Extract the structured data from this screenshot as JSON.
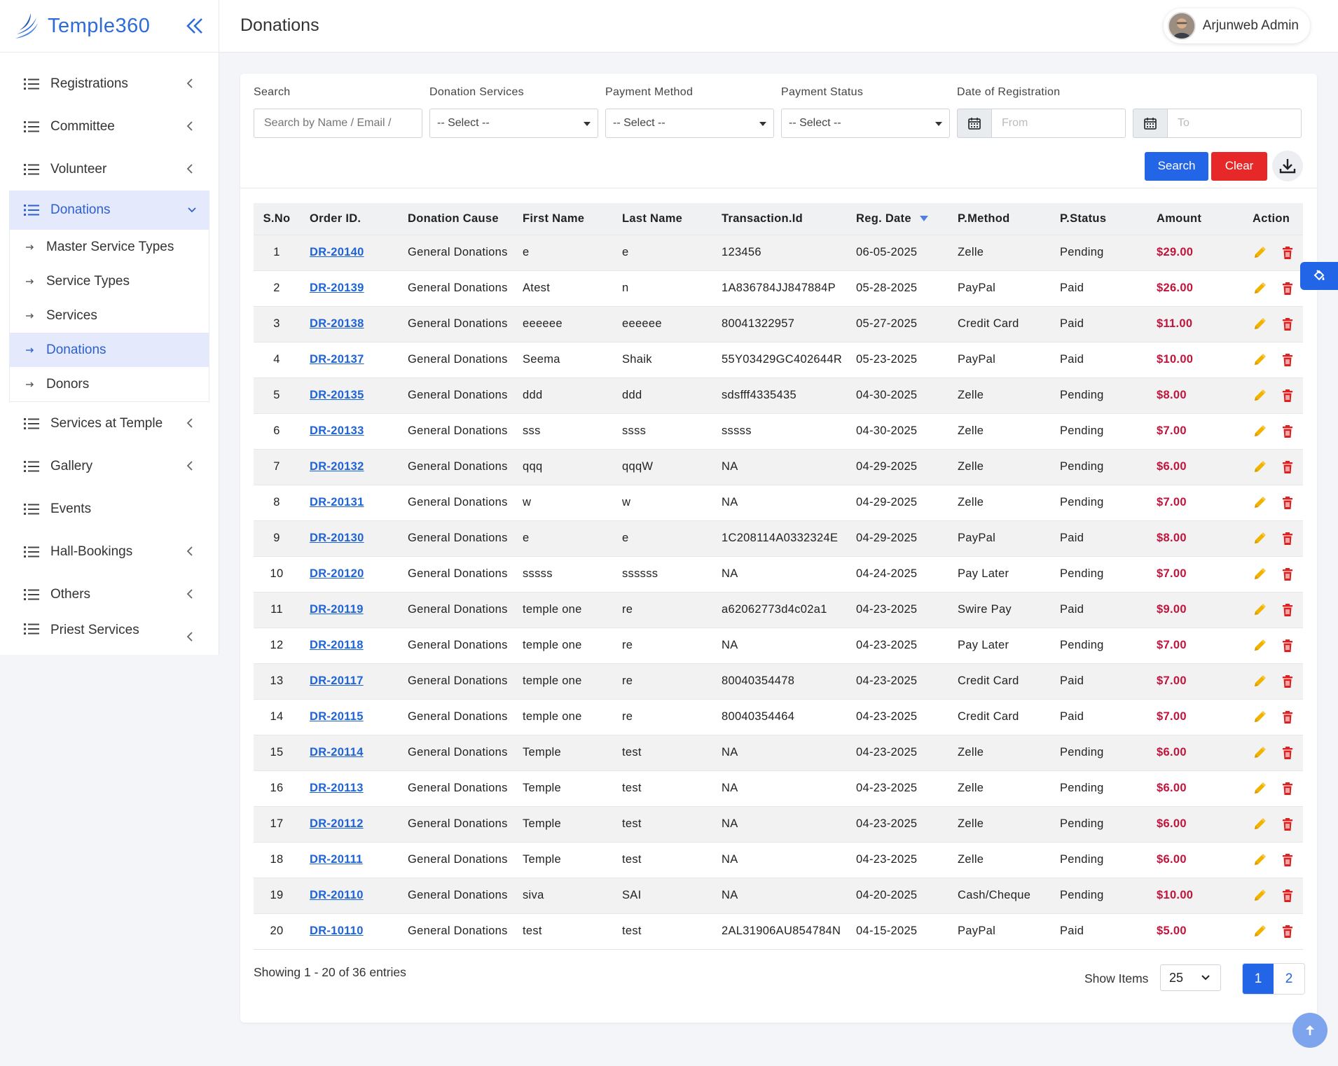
{
  "brand": {
    "name": "Temple360"
  },
  "header": {
    "title": "Donations",
    "user_name": "Arjunweb Admin"
  },
  "sidebar": {
    "items": [
      {
        "label": "Registrations",
        "icon": "list-icon",
        "has_chevron": true
      },
      {
        "label": "Committee",
        "icon": "list-icon",
        "has_chevron": true
      },
      {
        "label": "Volunteer",
        "icon": "list-icon",
        "has_chevron": true
      },
      {
        "label": "Donations",
        "icon": "list-icon",
        "has_chevron": true,
        "open": true
      },
      {
        "label": "Services at Temple",
        "icon": "list-icon",
        "has_chevron": true
      },
      {
        "label": "Gallery",
        "icon": "list-icon",
        "has_chevron": true
      },
      {
        "label": "Events",
        "icon": "list-icon",
        "has_chevron": false
      },
      {
        "label": "Hall-Bookings",
        "icon": "list-icon",
        "has_chevron": true
      },
      {
        "label": "Others",
        "icon": "list-icon",
        "has_chevron": true
      },
      {
        "label": "Priest Services",
        "icon": "list-icon",
        "has_chevron": true
      }
    ],
    "donations_submenu": [
      {
        "label": "Master Service Types",
        "active": false
      },
      {
        "label": "Service Types",
        "active": false
      },
      {
        "label": "Services",
        "active": false
      },
      {
        "label": "Donations",
        "active": true
      },
      {
        "label": "Donors",
        "active": false
      }
    ]
  },
  "filters": {
    "search": {
      "label": "Search",
      "placeholder": "Search by Name / Email /"
    },
    "donation_services": {
      "label": "Donation Services",
      "value": "-- Select --"
    },
    "payment_method": {
      "label": "Payment Method",
      "value": "-- Select --"
    },
    "payment_status": {
      "label": "Payment Status",
      "value": "-- Select --"
    },
    "date_of_registration": {
      "label": "Date of Registration",
      "from_placeholder": "From",
      "to_placeholder": "To"
    }
  },
  "actions": {
    "search_label": "Search",
    "clear_label": "Clear"
  },
  "table": {
    "columns": [
      "S.No",
      "Order ID.",
      "Donation Cause",
      "First Name",
      "Last Name",
      "Transaction.Id",
      "Reg. Date",
      "P.Method",
      "P.Status",
      "Amount",
      "Action"
    ],
    "rows": [
      {
        "sno": "1",
        "order": "DR-20140",
        "cause": "General Donations",
        "first": "e",
        "last": "e",
        "tx": "123456",
        "date": "06-05-2025",
        "method": "Zelle",
        "status": "Pending",
        "amount": "$29.00"
      },
      {
        "sno": "2",
        "order": "DR-20139",
        "cause": "General Donations",
        "first": "Atest",
        "last": "n",
        "tx": "1A836784JJ847884P",
        "date": "05-28-2025",
        "method": "PayPal",
        "status": "Paid",
        "amount": "$26.00"
      },
      {
        "sno": "3",
        "order": "DR-20138",
        "cause": "General Donations",
        "first": "eeeeee",
        "last": "eeeeee",
        "tx": "80041322957",
        "date": "05-27-2025",
        "method": "Credit Card",
        "status": "Paid",
        "amount": "$11.00"
      },
      {
        "sno": "4",
        "order": "DR-20137",
        "cause": "General Donations",
        "first": "Seema",
        "last": "Shaik",
        "tx": "55Y03429GC402644R",
        "date": "05-23-2025",
        "method": "PayPal",
        "status": "Paid",
        "amount": "$10.00"
      },
      {
        "sno": "5",
        "order": "DR-20135",
        "cause": "General Donations",
        "first": "ddd",
        "last": "ddd",
        "tx": "sdsfff4335435",
        "date": "04-30-2025",
        "method": "Zelle",
        "status": "Pending",
        "amount": "$8.00"
      },
      {
        "sno": "6",
        "order": "DR-20133",
        "cause": "General Donations",
        "first": "sss",
        "last": "ssss",
        "tx": "sssss",
        "date": "04-30-2025",
        "method": "Zelle",
        "status": "Pending",
        "amount": "$7.00"
      },
      {
        "sno": "7",
        "order": "DR-20132",
        "cause": "General Donations",
        "first": "qqq",
        "last": "qqqW",
        "tx": "NA",
        "date": "04-29-2025",
        "method": "Zelle",
        "status": "Pending",
        "amount": "$6.00"
      },
      {
        "sno": "8",
        "order": "DR-20131",
        "cause": "General Donations",
        "first": "w",
        "last": "w",
        "tx": "NA",
        "date": "04-29-2025",
        "method": "Zelle",
        "status": "Pending",
        "amount": "$7.00"
      },
      {
        "sno": "9",
        "order": "DR-20130",
        "cause": "General Donations",
        "first": "e",
        "last": "e",
        "tx": "1C208114A0332324E",
        "date": "04-29-2025",
        "method": "PayPal",
        "status": "Paid",
        "amount": "$8.00"
      },
      {
        "sno": "10",
        "order": "DR-20120",
        "cause": "General Donations",
        "first": "sssss",
        "last": "ssssss",
        "tx": "NA",
        "date": "04-24-2025",
        "method": "Pay Later",
        "status": "Pending",
        "amount": "$7.00"
      },
      {
        "sno": "11",
        "order": "DR-20119",
        "cause": "General Donations",
        "first": "temple one",
        "last": "re",
        "tx": "a62062773d4c02a1",
        "date": "04-23-2025",
        "method": "Swire Pay",
        "status": "Paid",
        "amount": "$9.00"
      },
      {
        "sno": "12",
        "order": "DR-20118",
        "cause": "General Donations",
        "first": "temple one",
        "last": "re",
        "tx": "NA",
        "date": "04-23-2025",
        "method": "Pay Later",
        "status": "Pending",
        "amount": "$7.00"
      },
      {
        "sno": "13",
        "order": "DR-20117",
        "cause": "General Donations",
        "first": "temple one",
        "last": "re",
        "tx": "80040354478",
        "date": "04-23-2025",
        "method": "Credit Card",
        "status": "Paid",
        "amount": "$7.00"
      },
      {
        "sno": "14",
        "order": "DR-20115",
        "cause": "General Donations",
        "first": "temple one",
        "last": "re",
        "tx": "80040354464",
        "date": "04-23-2025",
        "method": "Credit Card",
        "status": "Paid",
        "amount": "$7.00"
      },
      {
        "sno": "15",
        "order": "DR-20114",
        "cause": "General Donations",
        "first": "Temple",
        "last": "test",
        "tx": "NA",
        "date": "04-23-2025",
        "method": "Zelle",
        "status": "Pending",
        "amount": "$6.00"
      },
      {
        "sno": "16",
        "order": "DR-20113",
        "cause": "General Donations",
        "first": "Temple",
        "last": "test",
        "tx": "NA",
        "date": "04-23-2025",
        "method": "Zelle",
        "status": "Pending",
        "amount": "$6.00"
      },
      {
        "sno": "17",
        "order": "DR-20112",
        "cause": "General Donations",
        "first": "Temple",
        "last": "test",
        "tx": "NA",
        "date": "04-23-2025",
        "method": "Zelle",
        "status": "Pending",
        "amount": "$6.00"
      },
      {
        "sno": "18",
        "order": "DR-20111",
        "cause": "General Donations",
        "first": "Temple",
        "last": "test",
        "tx": "NA",
        "date": "04-23-2025",
        "method": "Zelle",
        "status": "Pending",
        "amount": "$6.00"
      },
      {
        "sno": "19",
        "order": "DR-20110",
        "cause": "General Donations",
        "first": "siva",
        "last": "SAI",
        "tx": "NA",
        "date": "04-20-2025",
        "method": "Cash/Cheque",
        "status": "Pending",
        "amount": "$10.00"
      },
      {
        "sno": "20",
        "order": "DR-10110",
        "cause": "General Donations",
        "first": "test",
        "last": "test",
        "tx": "2AL31906AU854784N",
        "date": "04-15-2025",
        "method": "PayPal",
        "status": "Paid",
        "amount": "$5.00"
      }
    ]
  },
  "footer": {
    "showing_text": "Showing 1 - 20 of 36 entries",
    "show_items_label": "Show Items",
    "page_size": "25",
    "pages": [
      "1",
      "2"
    ],
    "current_page": "1"
  },
  "colors": {
    "primary": "#2265e6",
    "danger": "#e62828",
    "amount": "#c0143c",
    "edit_icon": "#f0b400",
    "delete_icon": "#e02020"
  }
}
